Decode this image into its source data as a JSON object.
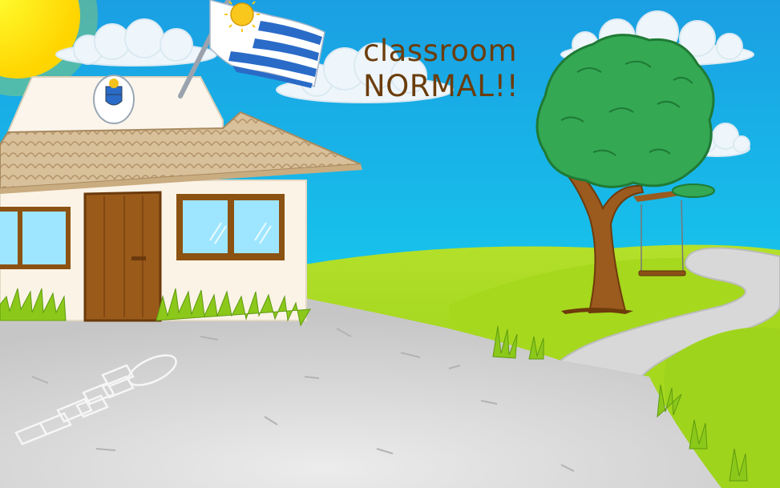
{
  "caption": {
    "line1": "classroom",
    "line2": "NORMAL!!"
  },
  "colors": {
    "sky_top": "#1a9fe3",
    "sky_bottom": "#14d6f0",
    "sun": "#ffee00",
    "grass": "#9fd41c",
    "grass_dark": "#7cbd12",
    "pavement": "#cfcfcf",
    "wall": "#fbf3e6",
    "roof": "#d9c3a1",
    "door": "#9a5a1a",
    "tree_leaves": "#34a853",
    "tree_trunk": "#9b5a1e",
    "text": "#6b3d0c",
    "flag_blue": "#2a6bc8"
  },
  "icons": [
    "sun-icon",
    "flag-icon",
    "school-emblem-icon",
    "tree-icon",
    "swing-icon",
    "hopscotch-icon"
  ]
}
